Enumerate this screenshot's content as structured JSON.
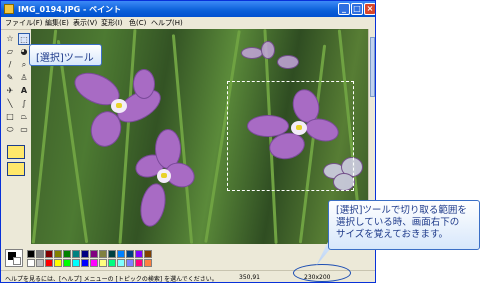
{
  "window": {
    "title": "IMG_0194.JPG - ペイント",
    "minimize": "_",
    "maximize": "□",
    "close": "×"
  },
  "menu": [
    "ファイル(F)",
    "編集(E)",
    "表示(V)",
    "変形(I)",
    "色(C)",
    "ヘルプ(H)"
  ],
  "tools": [
    {
      "icon": "free-select-icon",
      "glyph": "☆"
    },
    {
      "icon": "rect-select-icon",
      "glyph": "⬚"
    },
    {
      "icon": "eraser-icon",
      "glyph": "▱"
    },
    {
      "icon": "fill-bucket-icon",
      "glyph": "◕"
    },
    {
      "icon": "eyedropper-icon",
      "glyph": "/"
    },
    {
      "icon": "magnifier-icon",
      "glyph": "⌕"
    },
    {
      "icon": "pencil-icon",
      "glyph": "✎"
    },
    {
      "icon": "brush-icon",
      "glyph": "♙"
    },
    {
      "icon": "airbrush-icon",
      "glyph": "✈"
    },
    {
      "icon": "text-icon",
      "glyph": "A"
    },
    {
      "icon": "line-icon",
      "glyph": "╲"
    },
    {
      "icon": "curve-icon",
      "glyph": "∫"
    },
    {
      "icon": "rectangle-icon",
      "glyph": "□"
    },
    {
      "icon": "polygon-icon",
      "glyph": "⏢"
    },
    {
      "icon": "ellipse-icon",
      "glyph": "⬭"
    },
    {
      "icon": "rounded-rect-icon",
      "glyph": "▭"
    }
  ],
  "palette": {
    "colors": [
      "#000000",
      "#808080",
      "#800000",
      "#808000",
      "#008000",
      "#008080",
      "#000080",
      "#800080",
      "#808040",
      "#004040",
      "#0080ff",
      "#004080",
      "#8000ff",
      "#804000",
      "#ffffff",
      "#c0c0c0",
      "#ff0000",
      "#ffff00",
      "#00ff00",
      "#00ffff",
      "#0000ff",
      "#ff00ff",
      "#ffff80",
      "#00ff80",
      "#80ffff",
      "#8080ff",
      "#ff0080",
      "#ff8040"
    ]
  },
  "status": {
    "help": "ヘルプを見るには、[ヘルプ] メニューの [トピックの検索] を選んでください。",
    "coordinates": "350,91",
    "selection_size": "230x200"
  },
  "callouts": {
    "tool_label": "[選択]ツール",
    "tip_lines": [
      "[選択]ツールで切り取る範囲を",
      "選択している時、画面右下の",
      "サイズを覚えておきます。"
    ]
  },
  "colors": {
    "accent": "#0a5fd8",
    "callout_text": "#1e3a8a"
  }
}
